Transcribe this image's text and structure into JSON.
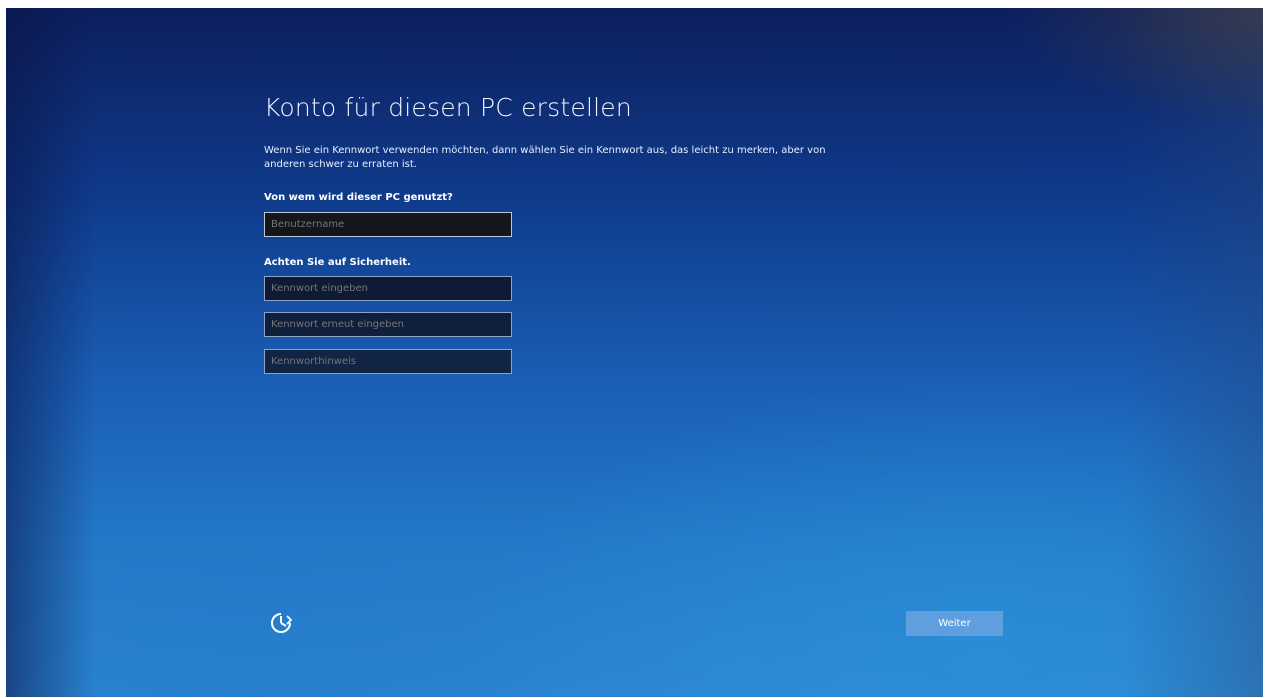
{
  "page": {
    "title": "Konto für diesen PC erstellen",
    "description": "Wenn Sie ein Kennwort verwenden möchten, dann wählen Sie ein Kennwort aus, das leicht zu merken, aber von anderen schwer zu erraten ist."
  },
  "user_section": {
    "label": "Von wem wird dieser PC genutzt?",
    "username_placeholder": "Benutzername"
  },
  "security_section": {
    "label": "Achten Sie auf Sicherheit.",
    "password_placeholder": "Kennwort eingeben",
    "password_confirm_placeholder": "Kennwort erneut eingeben",
    "password_hint_placeholder": "Kennworthinweis"
  },
  "footer": {
    "accessibility_icon": "ease-of-access-icon",
    "next_label": "Weiter"
  },
  "colors": {
    "background_top": "#0c1f5e",
    "background_bottom": "#2f86d2",
    "button_accent": "#5f9fe0",
    "field_background": "#0c1730",
    "text": "#ffffff"
  }
}
